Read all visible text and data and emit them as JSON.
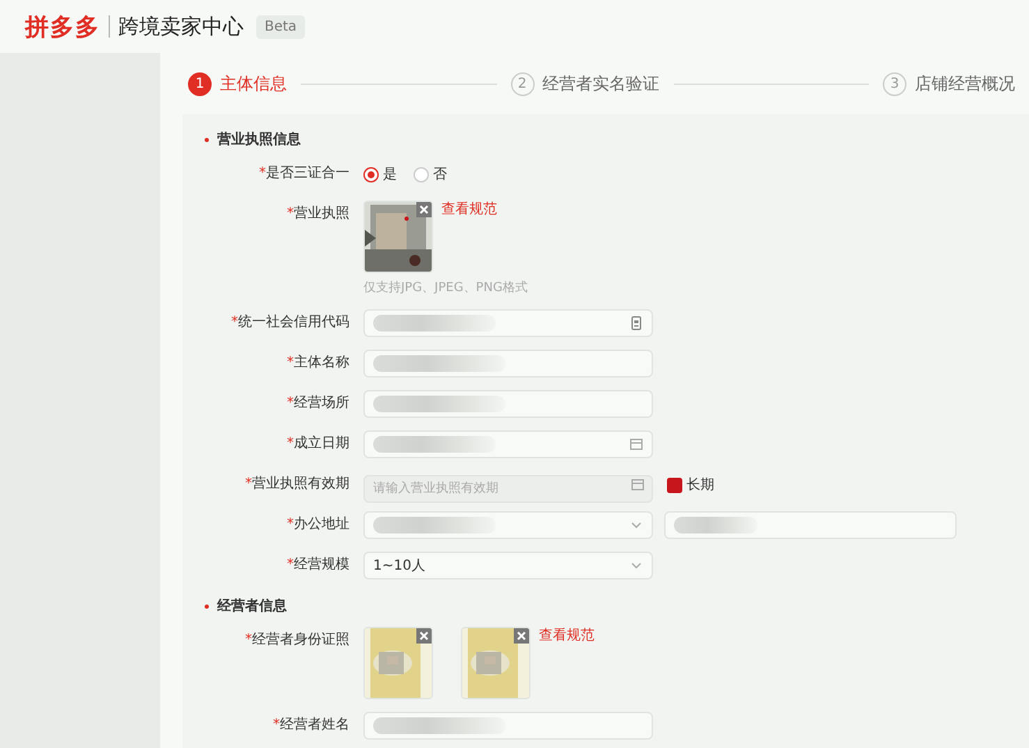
{
  "header": {
    "logo": "拼多多",
    "title": "跨境卖家中心",
    "badge": "Beta"
  },
  "steps": [
    {
      "number": "1",
      "label": "主体信息",
      "selected": true
    },
    {
      "number": "2",
      "label": "经营者实名验证",
      "selected": false
    },
    {
      "number": "3",
      "label": "店铺经营概况",
      "selected": false
    }
  ],
  "sections": [
    {
      "title": "营业执照信息",
      "fields": [
        {
          "kind": "radio",
          "mark": "*",
          "label": "是否三证合一",
          "options": [
            {
              "label": "是",
              "selected": true
            },
            {
              "label": "否",
              "selected": false
            }
          ]
        },
        {
          "kind": "upload",
          "mark": "*",
          "label": "营业执照",
          "link": "查看规范",
          "hint": "仅支持JPG、JPEG、PNG格式"
        },
        {
          "kind": "id-input",
          "mark": "*",
          "label": "统一社会信用代码",
          "value_hidden": true
        },
        {
          "kind": "input",
          "mark": "*",
          "label": "主体名称",
          "value_hidden": true
        },
        {
          "kind": "input",
          "mark": "*",
          "label": "经营场所",
          "value_hidden": true
        },
        {
          "kind": "date",
          "mark": "*",
          "label": "成立日期",
          "value_hidden": true
        },
        {
          "kind": "date",
          "mark": "*",
          "label": "营业执照有效期",
          "placeholder": "请输入营业执照有效期",
          "disabled": true,
          "checkbox": {
            "label": "长期",
            "checked": true
          }
        },
        {
          "kind": "select",
          "mark": "*",
          "label": "办公地址",
          "value_hidden": true,
          "extra_hidden": true
        },
        {
          "kind": "select",
          "mark": "*",
          "label": "经营规模",
          "value": "1~10人"
        }
      ]
    },
    {
      "title": "经营者信息",
      "fields": [
        {
          "kind": "upload",
          "mark": "*",
          "label": "经营者身份证照",
          "link": "查看规范"
        },
        {
          "kind": "input",
          "mark": "*",
          "label": "经营者姓名",
          "value_hidden": true
        }
      ]
    }
  ]
}
